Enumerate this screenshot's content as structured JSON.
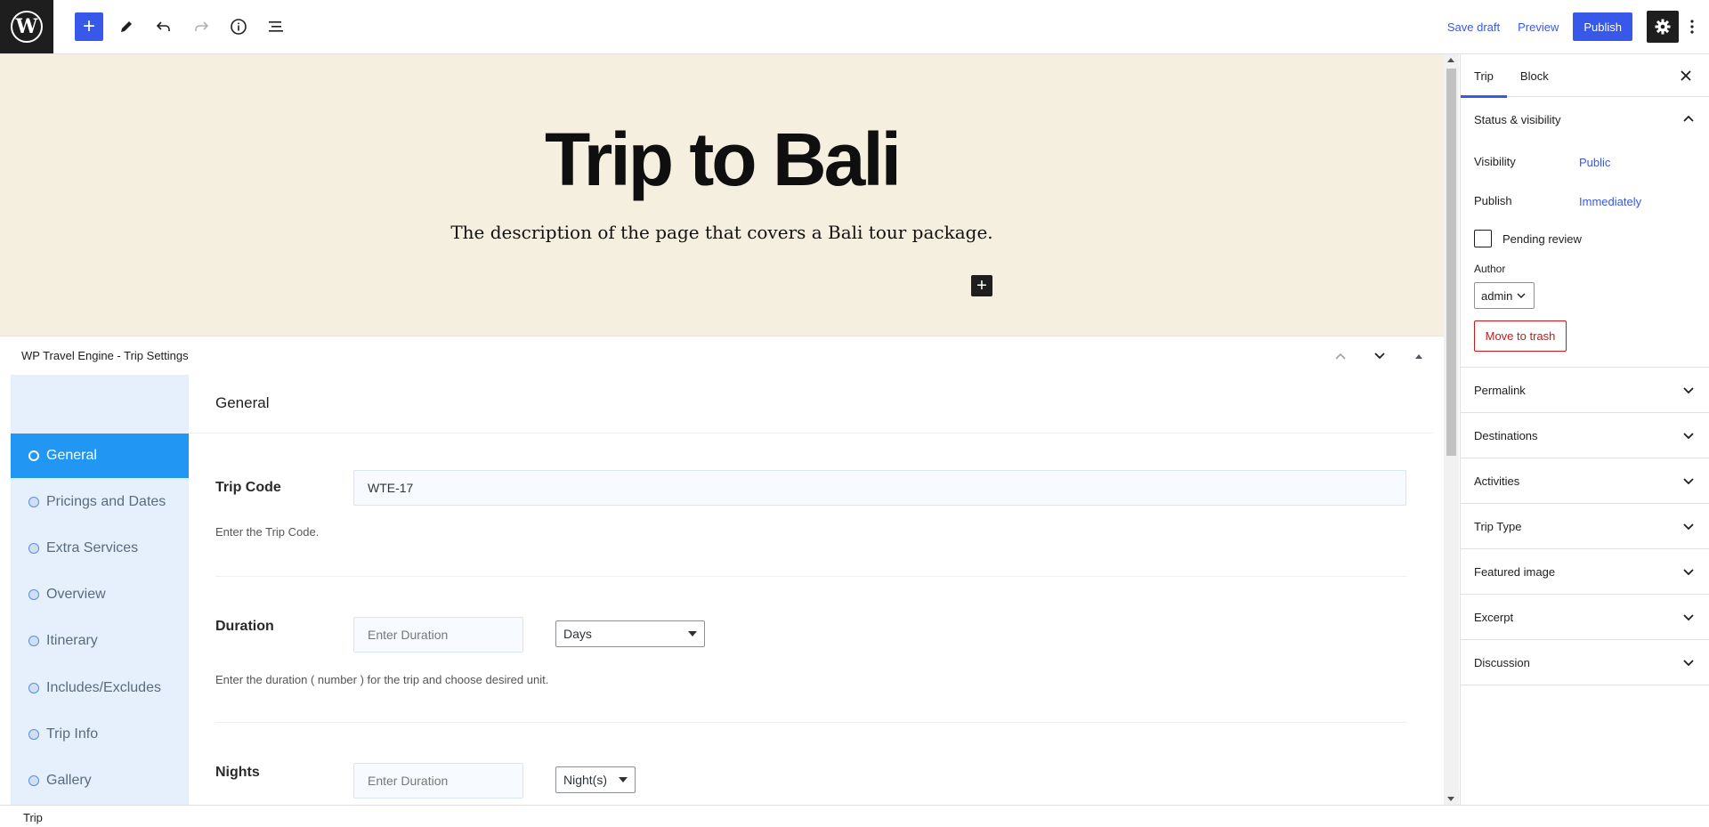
{
  "toolbar": {
    "save_draft": "Save draft",
    "preview": "Preview",
    "publish": "Publish",
    "accent": "#3858e9"
  },
  "hero": {
    "title": "Trip to Bali",
    "description": "The description of the page that covers a Bali tour package.",
    "background": "#f4efdf"
  },
  "metabox": {
    "title": "WP Travel Engine - Trip Settings",
    "tabs": [
      {
        "label": "General",
        "active": true
      },
      {
        "label": "Pricings and Dates"
      },
      {
        "label": "Extra Services"
      },
      {
        "label": "Overview"
      },
      {
        "label": "Itinerary"
      },
      {
        "label": "Includes/Excludes"
      },
      {
        "label": "Trip Info"
      },
      {
        "label": "Gallery"
      }
    ],
    "panel": {
      "title": "General",
      "trip_code": {
        "label": "Trip Code",
        "value": "WTE-17",
        "help": "Enter the Trip Code."
      },
      "duration": {
        "label": "Duration",
        "placeholder": "Enter Duration",
        "unit": "Days",
        "help": "Enter the duration ( number ) for the trip and choose desired unit."
      },
      "nights": {
        "label": "Nights",
        "placeholder": "Enter Duration",
        "unit": "Night(s)"
      }
    }
  },
  "sidebar": {
    "tabs": [
      "Trip",
      "Block"
    ],
    "status": {
      "title": "Status & visibility",
      "visibility_label": "Visibility",
      "visibility_value": "Public",
      "publish_label": "Publish",
      "publish_value": "Immediately",
      "pending_label": "Pending review",
      "author_label": "Author",
      "author_value": "admin",
      "trash": "Move to trash"
    },
    "sections": [
      "Permalink",
      "Destinations",
      "Activities",
      "Trip Type",
      "Featured image",
      "Excerpt",
      "Discussion"
    ]
  },
  "footer": {
    "breadcrumb": "Trip"
  }
}
